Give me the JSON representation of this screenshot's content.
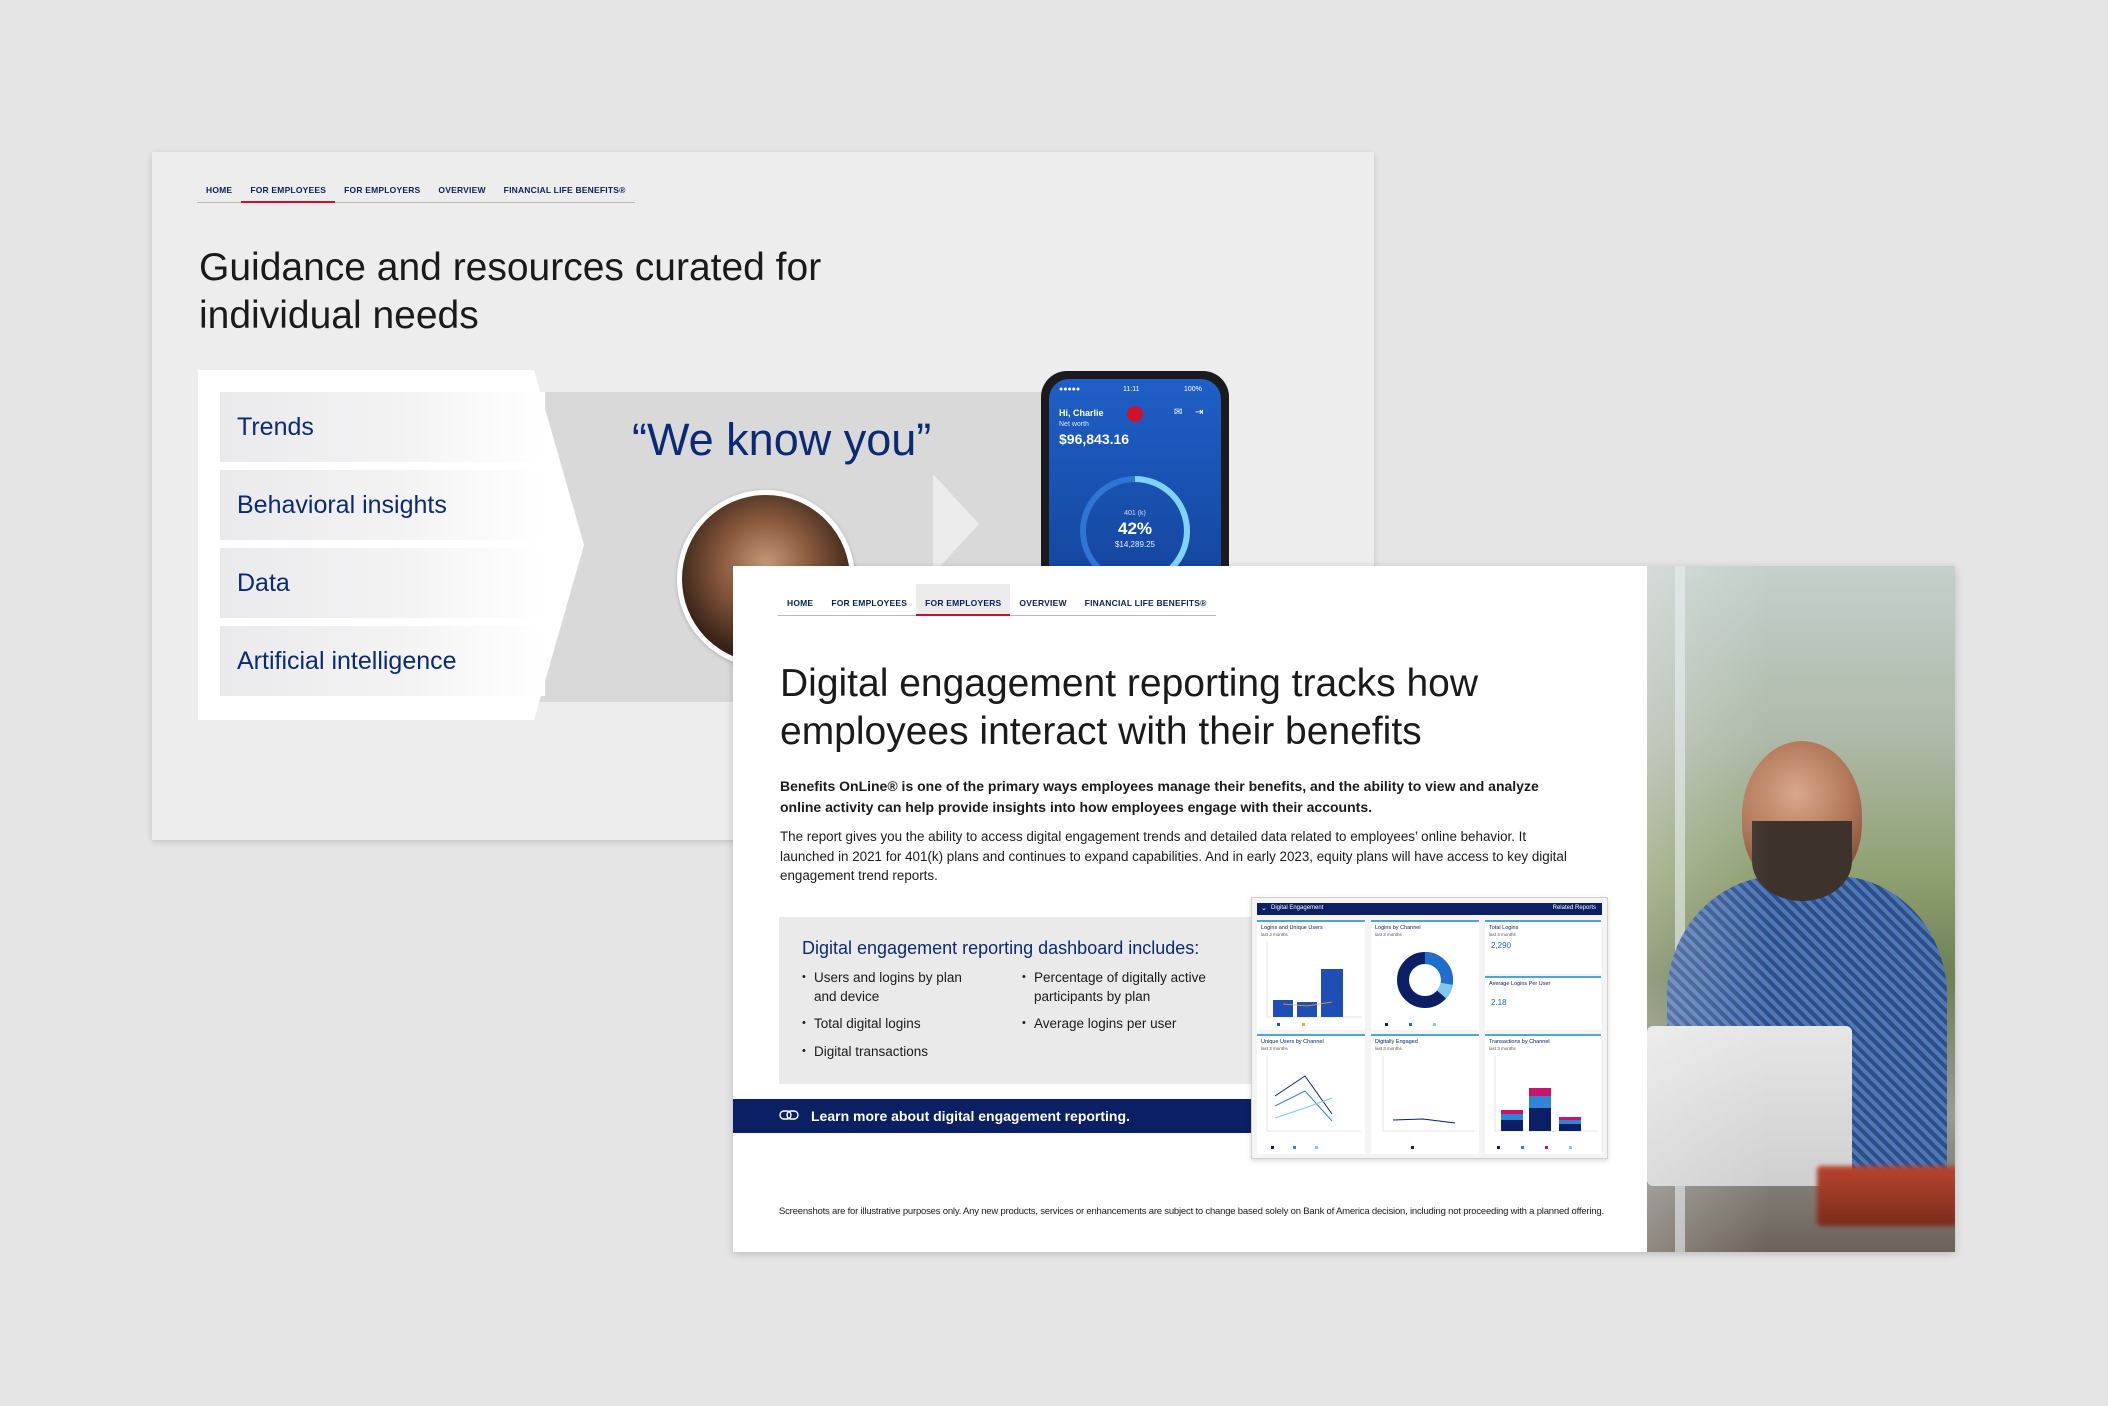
{
  "back": {
    "nav": [
      "HOME",
      "FOR EMPLOYEES",
      "FOR EMPLOYERS",
      "OVERVIEW",
      "FINANCIAL LIFE BENEFITS®"
    ],
    "title": "Guidance and resources curated for individual needs",
    "items": [
      "Trends",
      "Behavioral insights",
      "Data",
      "Artificial intelligence"
    ],
    "quote": "“We know you”",
    "phone": {
      "time": "11:11",
      "signal": "●●●●●",
      "battery": "100%",
      "greeting": "Hi, Charlie",
      "networth_label": "Net worth",
      "networth": "$96,843.16",
      "account": "401 (k)",
      "percent": "42%",
      "balance": "$14,289.25"
    }
  },
  "front": {
    "nav": [
      "HOME",
      "FOR EMPLOYEES",
      "FOR EMPLOYERS",
      "OVERVIEW",
      "FINANCIAL LIFE BENEFITS®"
    ],
    "title": "Digital engagement reporting tracks how employees interact with their benefits",
    "intro": "Benefits OnLine® is one of the primary ways employees manage their benefits, and the ability to view and analyze online activity can help provide insights into how employees engage with their accounts.",
    "body": "The report gives you the ability to access digital engagement trends and detailed data related to employees’ online behavior. It launched in 2021 for 401(k) plans and continues to expand capabilities. And in early 2023, equity plans will have access to key digital engagement trend reports.",
    "dashboard_heading": "Digital engagement reporting dashboard includes:",
    "bullets_left": [
      "Users and logins by plan and device",
      "Total digital logins",
      "Digital transactions"
    ],
    "bullets_right": [
      "Percentage of digitally active participants by plan",
      "Average logins per user"
    ],
    "learn_more": "Learn more about digital engagement reporting.",
    "disclaimer": "Screenshots are for illustrative purposes only. Any new products, services or enhancements are subject to change based solely on Bank of America decision, including not proceeding with a planned offering."
  },
  "dash": {
    "title": "Digital Engagement",
    "related": "Related Reports",
    "panels": {
      "logins": {
        "title": "Logins and Unique Users",
        "sub": "last 3 months"
      },
      "channel": {
        "title": "Logins by Channel",
        "sub": "last 3 months"
      },
      "total": {
        "title": "Total Logins",
        "sub": "last 3 months",
        "value": "2,290"
      },
      "avg": {
        "title": "Average Logins Per User",
        "value": "2.18"
      },
      "unique": {
        "title": "Unique Users by Channel",
        "sub": "last 3 months"
      },
      "engaged": {
        "title": "Digitally Engaged",
        "sub": "last 3 months"
      },
      "transactions": {
        "title": "Transactions by Channel",
        "sub": "last 3 months"
      }
    }
  },
  "colors": {
    "navy": "#0b2064",
    "brand_blue": "#0b2a74",
    "accent_red": "#c8102e"
  }
}
